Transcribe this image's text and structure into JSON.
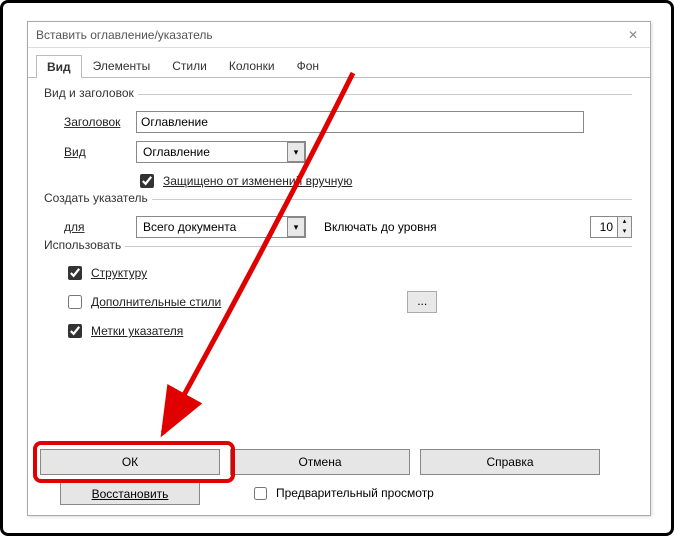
{
  "window": {
    "title": "Вставить оглавление/указатель"
  },
  "tabs": [
    "Вид",
    "Элементы",
    "Стили",
    "Колонки",
    "Фон"
  ],
  "active_tab": 0,
  "section_view": {
    "legend": "Вид и заголовок",
    "title_label": "Заголовок",
    "title_value": "Оглавление",
    "type_label": "Вид",
    "type_value": "Оглавление",
    "protected_label": "Защищено от изменений вручную",
    "protected_checked": true
  },
  "section_index": {
    "legend": "Создать указатель",
    "for_label": "для",
    "for_value": "Всего документа",
    "level_label": "Включать до уровня",
    "level_value": "10"
  },
  "section_use": {
    "legend": "Использовать",
    "structure_label": "Структуру",
    "structure_checked": true,
    "extra_styles_label": "Дополнительные стили",
    "extra_styles_checked": false,
    "extra_btn": "...",
    "marks_label": "Метки указателя",
    "marks_checked": true
  },
  "footer": {
    "ok": "ОК",
    "cancel": "Отмена",
    "help": "Справка",
    "restore": "Восстановить",
    "preview_label": "Предварительный просмотр",
    "preview_checked": false
  }
}
